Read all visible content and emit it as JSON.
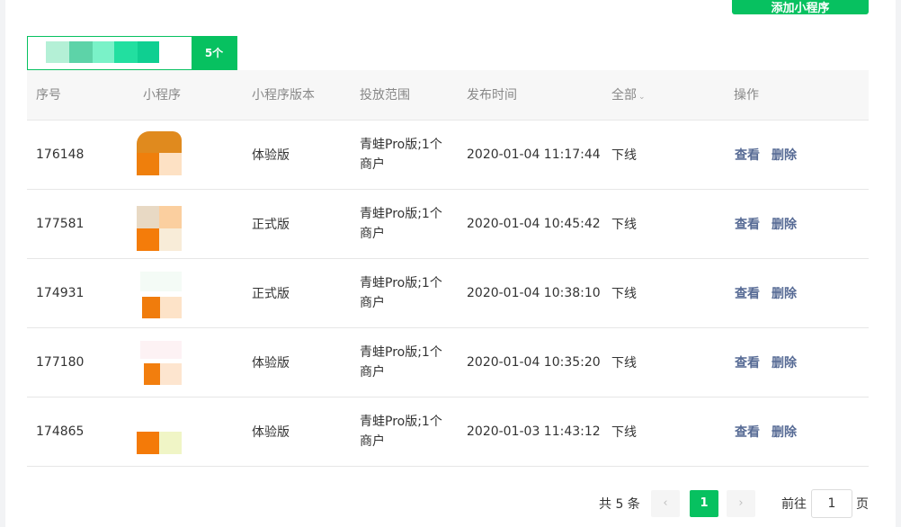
{
  "toolbar": {
    "add_button_label": "添加小程序"
  },
  "filter": {
    "count_label": "5个"
  },
  "table": {
    "headers": {
      "id": "序号",
      "miniprogram": "小程序",
      "version": "小程序版本",
      "scope": "投放范围",
      "publish_time": "发布时间",
      "status_filter": "全部"
    },
    "headers_ops": "操作",
    "rows": [
      {
        "id": "176148",
        "version": "体验版",
        "scope": "青蛙Pro版;1个商户",
        "time": "2020-01-04 11:17:44",
        "status": "下线",
        "view": "查看",
        "delete": "删除"
      },
      {
        "id": "177581",
        "version": "正式版",
        "scope": "青蛙Pro版;1个商户",
        "time": "2020-01-04 10:45:42",
        "status": "下线",
        "view": "查看",
        "delete": "删除"
      },
      {
        "id": "174931",
        "version": "正式版",
        "scope": "青蛙Pro版;1个商户",
        "time": "2020-01-04 10:38:10",
        "status": "下线",
        "view": "查看",
        "delete": "删除"
      },
      {
        "id": "177180",
        "version": "体验版",
        "scope": "青蛙Pro版;1个商户",
        "time": "2020-01-04 10:35:20",
        "status": "下线",
        "view": "查看",
        "delete": "删除"
      },
      {
        "id": "174865",
        "version": "体验版",
        "scope": "青蛙Pro版;1个商户",
        "time": "2020-01-03 11:43:12",
        "status": "下线",
        "view": "查看",
        "delete": "删除"
      }
    ]
  },
  "pagination": {
    "total": "共 5 条",
    "current": "1",
    "goto_prefix": "前往",
    "goto_value": "1",
    "goto_suffix": "页",
    "prev_icon": "chevron-left-icon",
    "next_icon": "chevron-right-icon"
  },
  "colors": {
    "accent": "#07c160",
    "link": "#576b95"
  }
}
